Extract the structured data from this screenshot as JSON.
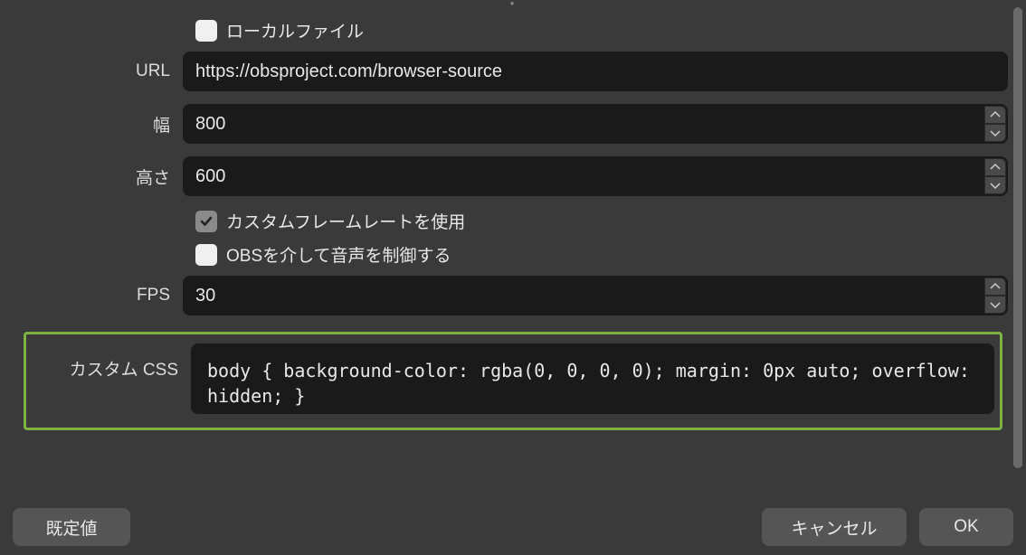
{
  "checkboxes": {
    "localFile": {
      "label": "ローカルファイル",
      "checked": false
    },
    "customFrameRate": {
      "label": "カスタムフレームレートを使用",
      "checked": true
    },
    "controlAudio": {
      "label": "OBSを介して音声を制御する",
      "checked": false
    }
  },
  "fields": {
    "url": {
      "label": "URL",
      "value": "https://obsproject.com/browser-source"
    },
    "width": {
      "label": "幅",
      "value": "800"
    },
    "height": {
      "label": "高さ",
      "value": "600"
    },
    "fps": {
      "label": "FPS",
      "value": "30"
    },
    "customCss": {
      "label": "カスタム CSS",
      "value": "body { background-color: rgba(0, 0, 0, 0); margin: 0px auto; overflow: hidden; }"
    }
  },
  "buttons": {
    "defaults": "既定値",
    "cancel": "キャンセル",
    "ok": "OK"
  }
}
